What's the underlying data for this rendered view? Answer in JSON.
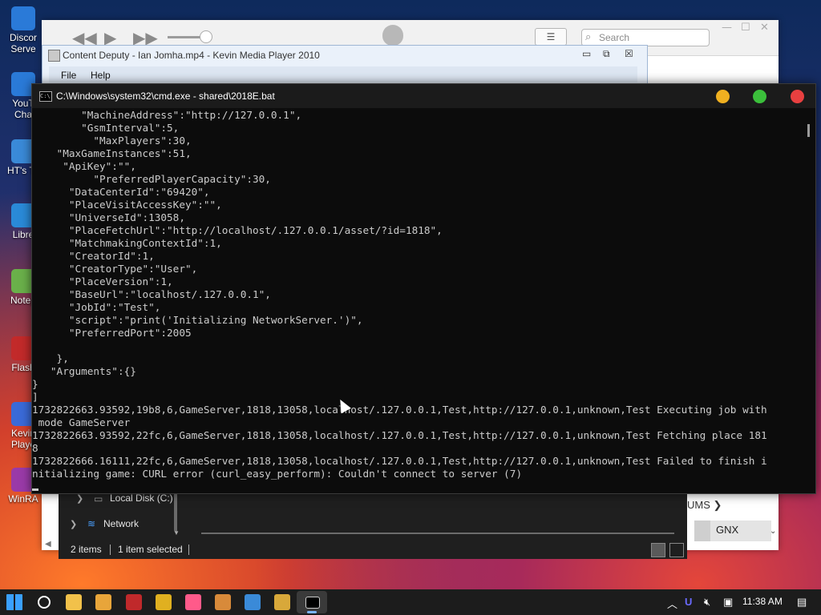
{
  "desktop": {
    "icons": [
      {
        "label": "Discor\nServe",
        "color": "#2a7ad8"
      },
      {
        "label": "YouT\nCha",
        "color": "#2a7ad8"
      },
      {
        "label": "HT's To",
        "color": "#3a8ad8"
      },
      {
        "label": "Libre",
        "color": "#2a8ad8"
      },
      {
        "label": "Notep",
        "color": "#6ab04a"
      },
      {
        "label": "Flash",
        "color": "#c22a2a"
      },
      {
        "label": "Kevin\nPlaye",
        "color": "#3a6ad8"
      },
      {
        "label": "WinRA",
        "color": "#9a3aa8"
      }
    ]
  },
  "itunes": {
    "search_placeholder": "Search",
    "forums_label": "UMS ❯",
    "gnx_label": "GNX"
  },
  "media_player": {
    "title": "Content Deputy - Ian Jomha.mp4 - Kevin Media Player 2010",
    "menu": [
      "File",
      "Help"
    ]
  },
  "cmd": {
    "title": "C:\\Windows\\system32\\cmd.exe - shared\\2018E.bat",
    "lights": {
      "yellow": "#f0b020",
      "green": "#3bbf3b",
      "red": "#e84040"
    },
    "lines": [
      "        \"MachineAddress\":\"http://127.0.0.1\",",
      "        \"GsmInterval\":5,",
      "          \"MaxPlayers\":30,",
      "    \"MaxGameInstances\":51,",
      "     \"ApiKey\":\"\",",
      "          \"PreferredPlayerCapacity\":30,",
      "      \"DataCenterId\":\"69420\",",
      "      \"PlaceVisitAccessKey\":\"\",",
      "      \"UniverseId\":13058,",
      "      \"PlaceFetchUrl\":\"http://localhost/.127.0.0.1/asset/?id=1818\",",
      "      \"MatchmakingContextId\":1,",
      "      \"CreatorId\":1,",
      "      \"CreatorType\":\"User\",",
      "      \"PlaceVersion\":1,",
      "      \"BaseUrl\":\"localhost/.127.0.0.1\",",
      "      \"JobId\":\"Test\",",
      "      \"script\":\"print('Initializing NetworkServer.')\",",
      "      \"PreferredPort\":2005",
      "",
      "    },",
      "   \"Arguments\":{}",
      "}",
      "]",
      "1732822663.93592,19b8,6,GameServer,1818,13058,localhost/.127.0.0.1,Test,http://127.0.0.1,unknown,Test Executing job with",
      " mode GameServer",
      "1732822663.93592,22fc,6,GameServer,1818,13058,localhost/.127.0.0.1,Test,http://127.0.0.1,unknown,Test Fetching place 181",
      "8",
      "1732822666.16111,22fc,6,GameServer,1818,13058,localhost/.127.0.0.1,Test,http://127.0.0.1,unknown,Test Failed to finish i",
      "nitializing game: CURL error (curl_easy_perform): Couldn't connect to server (7)"
    ]
  },
  "explorer": {
    "nav": [
      {
        "label": "Local Disk (C:)",
        "icon": "drive-icon"
      },
      {
        "label": "Network",
        "icon": "network-icon"
      }
    ],
    "status_count": "2 items",
    "status_selected": "1 item selected"
  },
  "taskbar": {
    "time": "11:38 AM",
    "apps": [
      {
        "name": "windows-start-icon",
        "color": "#3aa0ff"
      },
      {
        "name": "search-icon",
        "color": "#ffffff"
      },
      {
        "name": "file-explorer-icon",
        "color": "#f2c14a"
      },
      {
        "name": "store-icon",
        "color": "#e8a53a"
      },
      {
        "name": "flash-icon",
        "color": "#c0292b"
      },
      {
        "name": "chrome-icon",
        "color": "#e0b020"
      },
      {
        "name": "itunes-icon",
        "color": "#ff5a8a"
      },
      {
        "name": "media-player-icon",
        "color": "#d88a3a"
      },
      {
        "name": "app-icon",
        "color": "#3a8ad8"
      },
      {
        "name": "winrar-icon",
        "color": "#d8a83a"
      },
      {
        "name": "cmd-icon",
        "color": "#cccccc"
      }
    ]
  }
}
